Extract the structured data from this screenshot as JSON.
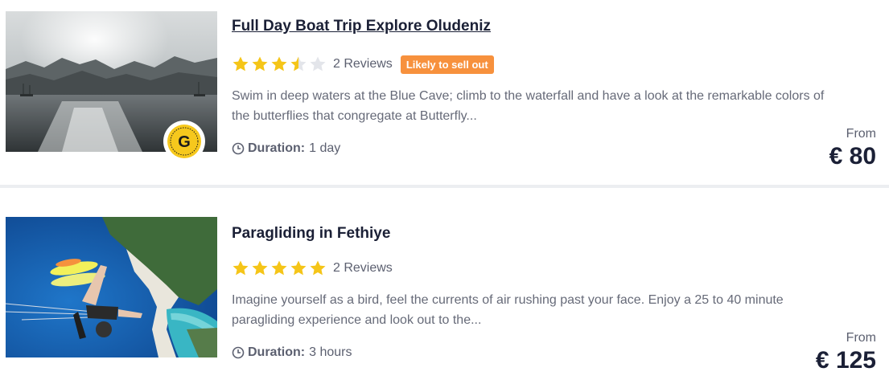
{
  "listings": [
    {
      "title": "Full Day Boat Trip Explore Oludeniz",
      "rating": 3.5,
      "rating_max": 5,
      "reviews": "2 Reviews",
      "tag": "Likely to sell out",
      "description": "Swim in deep waters at the Blue Cave; climb to the waterfall and have a look at the remarkable colors of the butterflies that congregate at Butterfly...",
      "duration_label": "Duration:",
      "duration_value": "1 day",
      "from_label": "From",
      "price": "€ 80",
      "badge_letter": "G",
      "image": "boat-trip-sunset-photo"
    },
    {
      "title": "Paragliding in Fethiye",
      "rating": 5,
      "rating_max": 5,
      "reviews": "2 Reviews",
      "description": "Imagine yourself as a bird, feel the currents of air rushing past your face. Enjoy a 25 to 40 minute paragliding experience and look out to the...",
      "duration_label": "Duration:",
      "duration_value": "3 hours",
      "from_label": "From",
      "price": "€ 125",
      "image": "paragliding-lagoon-photo"
    }
  ],
  "colors": {
    "star_filled": "#f5c518",
    "star_empty": "#e3e5ea",
    "tag_bg": "#f7913d",
    "badge_yellow": "#f6c81d"
  }
}
